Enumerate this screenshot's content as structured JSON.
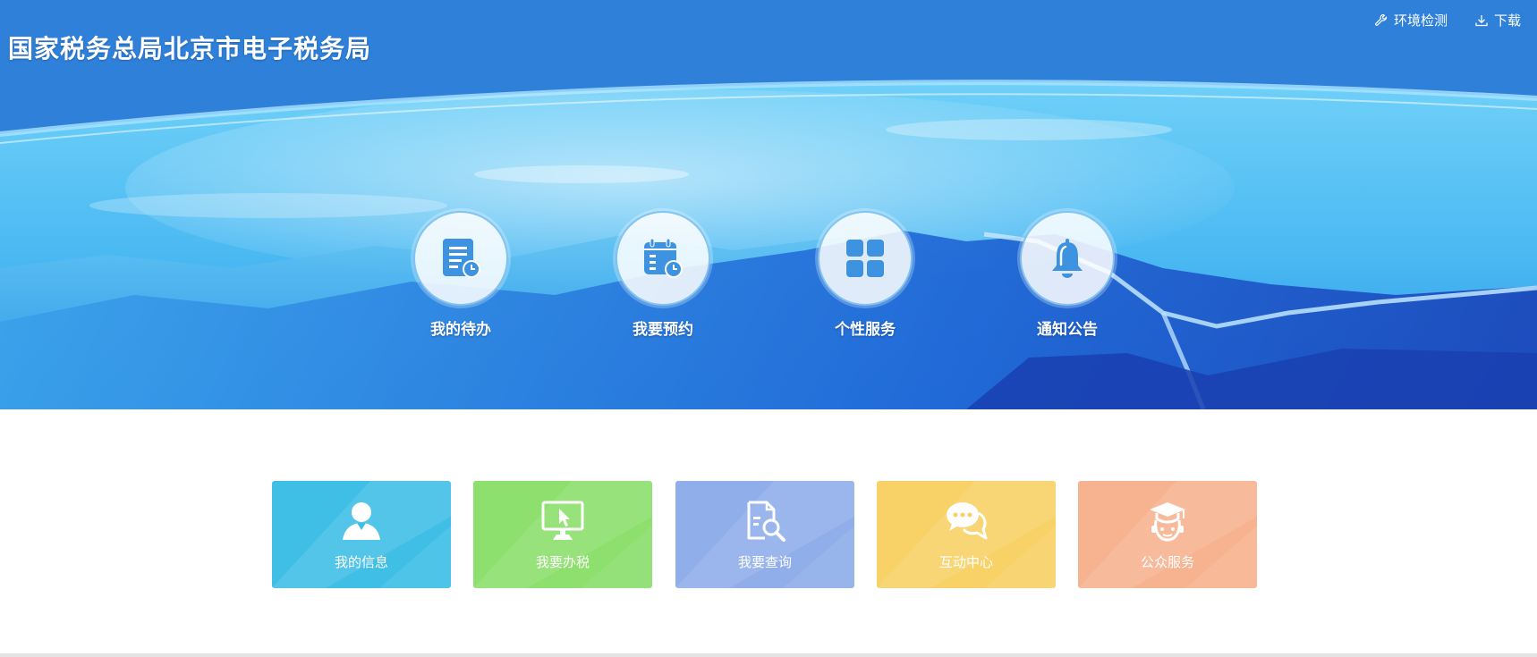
{
  "header": {
    "title": "国家税务总局北京市电子税务局",
    "links": [
      {
        "label": "环境检测",
        "icon": "wrench-icon"
      },
      {
        "label": "下载",
        "icon": "download-icon"
      }
    ]
  },
  "circle_nav": [
    {
      "label": "我的待办",
      "icon": "todo-document-icon"
    },
    {
      "label": "我要预约",
      "icon": "calendar-clock-icon"
    },
    {
      "label": "个性服务",
      "icon": "grid-apps-icon"
    },
    {
      "label": "通知公告",
      "icon": "bell-icon"
    }
  ],
  "tiles": [
    {
      "label": "我的信息",
      "icon": "user-icon",
      "color": "#3fbfe6"
    },
    {
      "label": "我要办税",
      "icon": "monitor-cursor-icon",
      "color": "#8ddf6e"
    },
    {
      "label": "我要查询",
      "icon": "document-search-icon",
      "color": "#8faeea"
    },
    {
      "label": "互动中心",
      "icon": "chat-bubbles-icon",
      "color": "#f8d267"
    },
    {
      "label": "公众服务",
      "icon": "graduate-icon",
      "color": "#f7b38f"
    }
  ],
  "colors": {
    "header_blue": "#2f7fd8",
    "icon_blue": "#3d93e0",
    "divider": "#e3e3e3"
  }
}
